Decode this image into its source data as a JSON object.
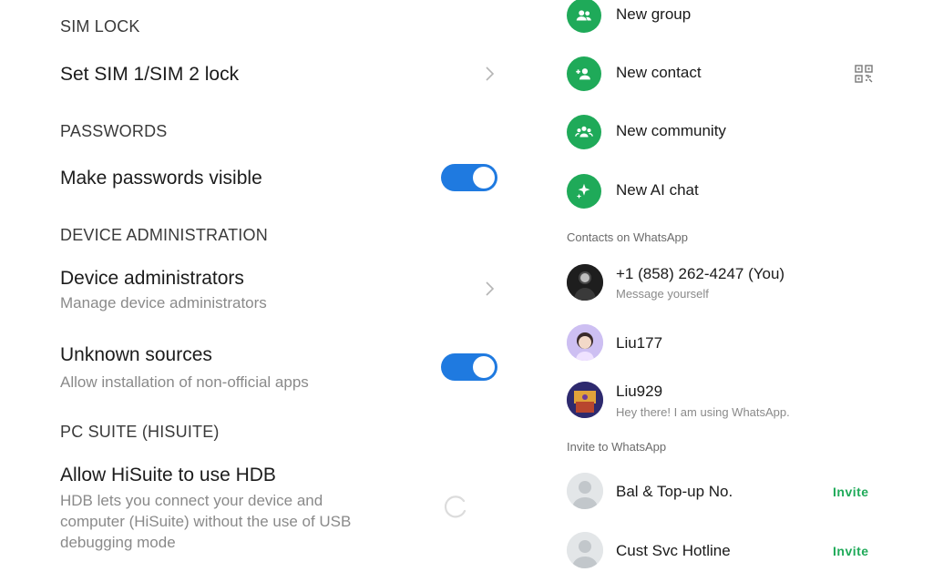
{
  "left": {
    "sim_section": "SIM LOCK",
    "sim_item": "Set SIM 1/SIM 2 lock",
    "passwords_section": "PASSWORDS",
    "passwords_item": "Make passwords visible",
    "device_admin_section": "DEVICE ADMINISTRATION",
    "device_admins_title": "Device administrators",
    "device_admins_sub": "Manage device administrators",
    "unknown_title": "Unknown sources",
    "unknown_sub": "Allow installation of non-official apps",
    "pcsuite_section": "PC SUITE (HISUITE)",
    "hisuite_title": "Allow HiSuite to use HDB",
    "hisuite_sub_1": "HDB lets you connect your device and",
    "hisuite_sub_2": "computer (HiSuite) without the use of USB",
    "hisuite_sub_3": "debugging mode",
    "toggles": {
      "passwords_visible": true,
      "unknown_sources": true
    },
    "accent": "#1f7ae0"
  },
  "right": {
    "actions": [
      {
        "label": "New group",
        "icon": "group-icon"
      },
      {
        "label": "New contact",
        "icon": "add-contact-icon"
      },
      {
        "label": "New community",
        "icon": "community-icon"
      },
      {
        "label": "New AI chat",
        "icon": "ai-sparkle-icon"
      }
    ],
    "contacts_section": "Contacts on WhatsApp",
    "contacts": [
      {
        "name": "+1 (858) 262-4247 (You)",
        "sub": "Message yourself"
      },
      {
        "name": "Liu177",
        "sub": ""
      },
      {
        "name": "Liu929",
        "sub": "Hey there! I am using WhatsApp."
      }
    ],
    "invite_section": "Invite to WhatsApp",
    "invites": [
      {
        "name": "Bal & Top-up No.",
        "action": "Invite"
      },
      {
        "name": "Cust Svc Hotline",
        "action": "Invite"
      }
    ],
    "accent": "#1faa59"
  }
}
